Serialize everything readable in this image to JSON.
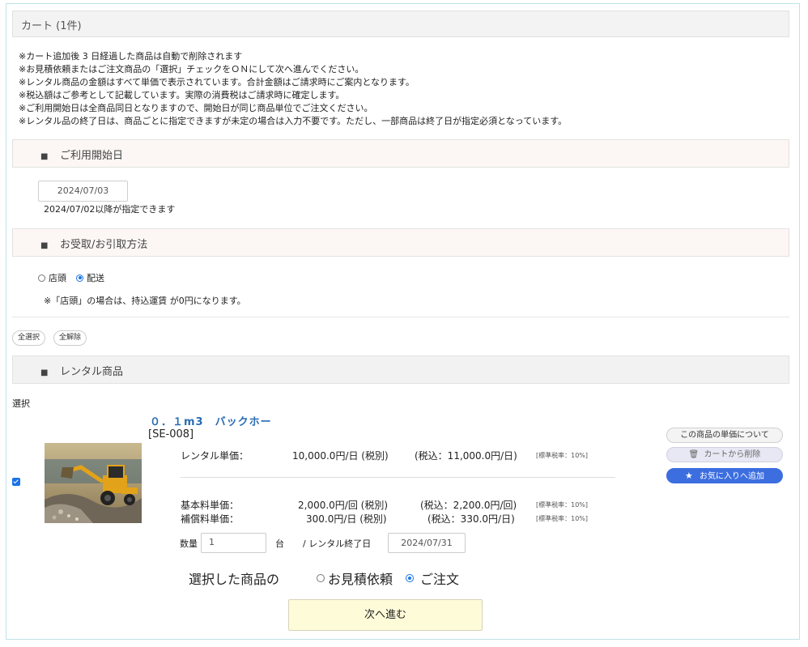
{
  "cart": {
    "title": "カート (1件)"
  },
  "notes": [
    "※カート追加後 3 日経過した商品は自動で削除されます",
    "※お見積依頼またはご注文商品の「選択」チェックをＯＮにして次へ進んでください。",
    "※レンタル商品の金額はすべて単価で表示されています。合計金額はご請求時にご案内となります。",
    "※税込額はご参考として記載しています。実際の消費税はご請求時に確定します。",
    "※ご利用開始日は全商品同日となりますので、開始日が同じ商品単位でご注文ください。",
    "※レンタル品の終了日は、商品ごとに指定できますが未定の場合は入力不要です。ただし、一部商品は終了日が指定必須となっています。"
  ],
  "start_date": {
    "heading": "ご利用開始日",
    "value": "2024/07/03",
    "note": "2024/07/02以降が指定できます"
  },
  "pickup": {
    "heading": "お受取/お引取方法",
    "options": [
      "店頭",
      "配送"
    ],
    "selected": "配送",
    "note": "※「店頭」の場合は、持込運賃 が0円になります。"
  },
  "selection_buttons": {
    "select_all": "全選択",
    "deselect_all": "全解除"
  },
  "rental_section": {
    "heading": "レンタル商品",
    "select_label": "選択"
  },
  "product": {
    "checked": true,
    "name": "０．１m3　バックホー",
    "code": "[SE-008]",
    "unit_price_label": "レンタル単価：",
    "unit_price": "10,000.0円/日 (税別)",
    "unit_price_tax": "(税込：11,000.0円/日)",
    "unit_tax_rate": "[標準税率：10%]",
    "base_fee_label": "基本料単価：",
    "base_fee": "2,000.0円/回 (税別)",
    "base_fee_tax": "(税込：2,200.0円/回)",
    "base_tax_rate": "[標準税率：10%]",
    "comp_fee_label": "補償料単価：",
    "comp_fee": "300.0円/日 (税別)",
    "comp_fee_tax": "(税込：330.0円/日)",
    "comp_tax_rate": "[標準税率：10%]",
    "qty_label": "数量",
    "qty_value": "1",
    "qty_unit": "台",
    "end_label": "/  レンタル終了日",
    "end_value": "2024/07/31",
    "btn_price_info": "この商品の単価について",
    "btn_remove": "カートから削除",
    "btn_favorite": "お気に入りへ追加"
  },
  "order_type": {
    "label": "選択した商品の",
    "options": [
      "お見積依頼",
      "ご注文"
    ],
    "selected": "ご注文"
  },
  "next_button": "次へ進む",
  "colors": {
    "accent": "#1a73e8",
    "favorite": "#3c6ee0",
    "next_bg": "#fefbd9",
    "product_name": "#2a6cb3"
  }
}
